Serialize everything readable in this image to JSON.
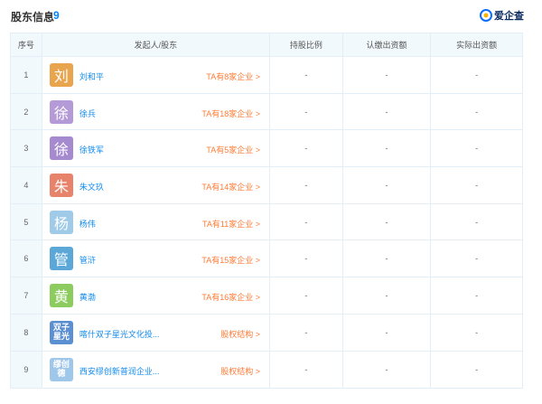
{
  "header": {
    "title": "股东信息",
    "count": "9",
    "brand": "爱企查"
  },
  "columns": {
    "idx": "序号",
    "name": "发起人/股东",
    "ratio": "持股比例",
    "paid": "认缴出资额",
    "actual": "实际出资额"
  },
  "rows": [
    {
      "idx": "1",
      "avatar": "刘",
      "avatar_color": "#e9a54e",
      "name": "刘和平",
      "link": "TA有8家企业 >",
      "ratio": "-",
      "paid": "-",
      "actual": "-"
    },
    {
      "idx": "2",
      "avatar": "徐",
      "avatar_color": "#b49ad6",
      "name": "徐兵",
      "link": "TA有18家企业 >",
      "ratio": "-",
      "paid": "-",
      "actual": "-"
    },
    {
      "idx": "3",
      "avatar": "徐",
      "avatar_color": "#a58ad0",
      "name": "徐铁军",
      "link": "TA有5家企业 >",
      "ratio": "-",
      "paid": "-",
      "actual": "-"
    },
    {
      "idx": "4",
      "avatar": "朱",
      "avatar_color": "#e8836b",
      "name": "朱文玖",
      "link": "TA有14家企业 >",
      "ratio": "-",
      "paid": "-",
      "actual": "-"
    },
    {
      "idx": "5",
      "avatar": "杨",
      "avatar_color": "#9fcbe8",
      "name": "杨伟",
      "link": "TA有11家企业 >",
      "ratio": "-",
      "paid": "-",
      "actual": "-"
    },
    {
      "idx": "6",
      "avatar": "管",
      "avatar_color": "#5aa7d8",
      "name": "管浒",
      "link": "TA有15家企业 >",
      "ratio": "-",
      "paid": "-",
      "actual": "-"
    },
    {
      "idx": "7",
      "avatar": "黄",
      "avatar_color": "#8ccc5f",
      "name": "黄渤",
      "link": "TA有16家企业 >",
      "ratio": "-",
      "paid": "-",
      "actual": "-"
    },
    {
      "idx": "8",
      "avatar": "双子\n星光",
      "avatar_color": "#5b8fd2",
      "name": "喀什双子星光文化投...",
      "link": "股权结构 >",
      "ratio": "-",
      "paid": "-",
      "actual": "-"
    },
    {
      "idx": "9",
      "avatar": "缪创\n德",
      "avatar_color": "#9fc7ea",
      "name": "西安缪创新普润企业...",
      "link": "股权结构 >",
      "ratio": "-",
      "paid": "-",
      "actual": "-"
    }
  ]
}
